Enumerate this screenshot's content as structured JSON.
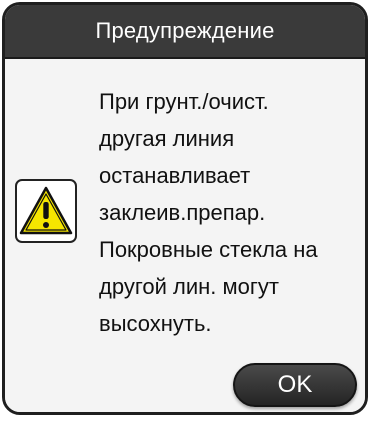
{
  "dialog": {
    "title": "Предупреждение",
    "icon": "warning-triangle-icon",
    "message": "При грунт./очист.\nдругая линия\nостанавливает\nзаклеив.препар.\nПокровные стекла на\nдругой лин. могут\nвысохнуть.",
    "ok_label": "OK"
  },
  "colors": {
    "titlebar": "#3a3a3a",
    "warning_fill": "#f5e600",
    "button": "#2e2e2e"
  }
}
